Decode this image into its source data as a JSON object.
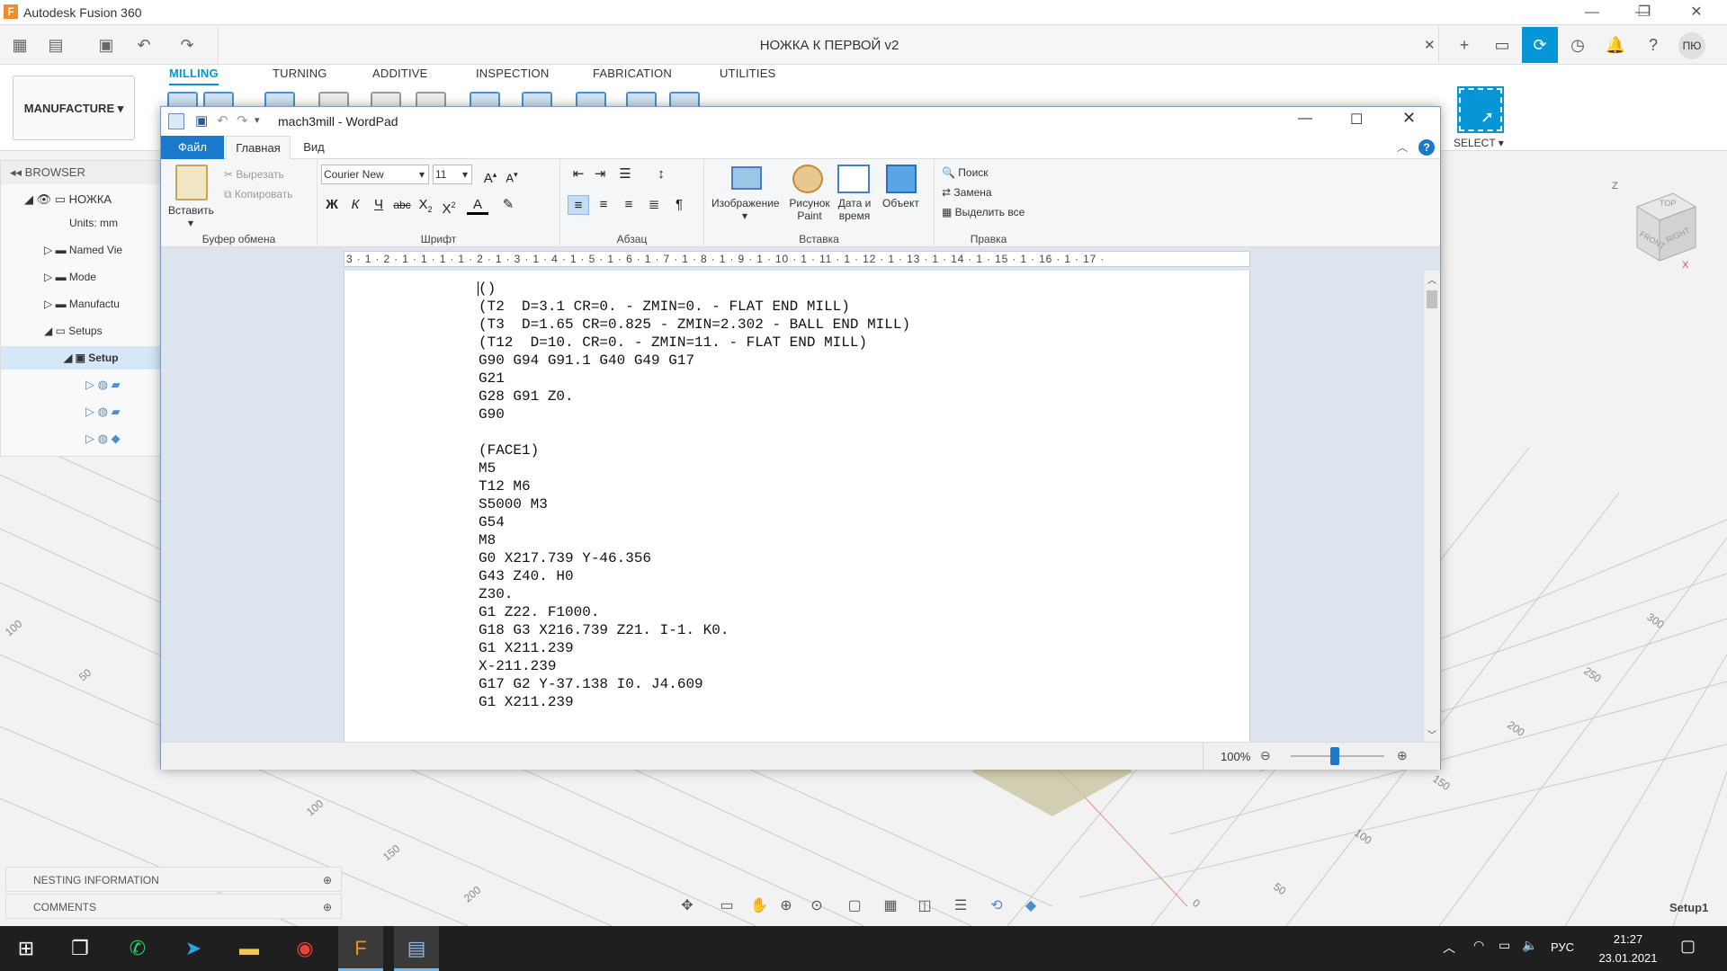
{
  "fusion": {
    "app_title": "Autodesk Fusion 360",
    "doc_name": "НОЖКА К ПЕРВОЙ v2",
    "user_initials": "ПЮ",
    "workspace": "MANUFACTURE",
    "tabs": [
      "MILLING",
      "TURNING",
      "ADDITIVE",
      "INSPECTION",
      "FABRICATION",
      "UTILITIES"
    ],
    "select_label": "SELECT ▾",
    "browser": {
      "header": "BROWSER",
      "root": "НОЖКА",
      "units": "Units: mm",
      "named_views": "Named Vie",
      "models": "Mode",
      "manufacture": "Manufactu",
      "setups": "Setups",
      "setup": "Setup"
    },
    "panels": {
      "nesting": "NESTING INFORMATION",
      "comments": "COMMENTS"
    },
    "status_right": "Setup1",
    "cube": {
      "top": "TOP",
      "front": "FRONT",
      "right": "RIGHT",
      "z": "Z",
      "x": "X"
    },
    "grid_labels": [
      "100",
      "50",
      "300",
      "250",
      "200",
      "150",
      "100",
      "50",
      "0",
      "200",
      "150",
      "100",
      "50",
      "0"
    ]
  },
  "wordpad": {
    "title": "mach3mill - WordPad",
    "tabs": {
      "file": "Файл",
      "home": "Главная",
      "view": "Вид"
    },
    "clipboard": {
      "paste": "Вставить",
      "cut": "Вырезать",
      "copy": "Копировать",
      "group": "Буфер обмена"
    },
    "font": {
      "name": "Courier New",
      "size": "11",
      "group": "Шрифт"
    },
    "paragraph_group": "Абзац",
    "insert": {
      "image": "Изображение",
      "paint_1": "Рисунок",
      "paint_2": "Paint",
      "datetime_1": "Дата и",
      "datetime_2": "время",
      "object": "Объект",
      "group": "Вставка"
    },
    "edit": {
      "find": "Поиск",
      "replace": "Замена",
      "select_all": "Выделить все",
      "group": "Правка"
    },
    "ruler_text": "3 · 1 · 2 · 1 · 1 · 1 · 1 · 2 · 1 · 3 · 1 · 4 · 1 · 5 · 1 · 6 · 1 · 7 · 1 · 8 · 1 · 9 · 1 · 10 · 1 · 11 · 1 · 12 · 1 · 13 · 1 · 14 · 1 · 15 · 1 · 16 · 1 · 17 ·",
    "lines": [
      "()",
      "(T2  D=3.1 CR=0. - ZMIN=0. - FLAT END MILL)",
      "(T3  D=1.65 CR=0.825 - ZMIN=2.302 - BALL END MILL)",
      "(T12  D=10. CR=0. - ZMIN=11. - FLAT END MILL)",
      "G90 G94 G91.1 G40 G49 G17",
      "G21",
      "G28 G91 Z0.",
      "G90",
      "",
      "(FACE1)",
      "M5",
      "T12 M6",
      "S5000 M3",
      "G54",
      "M8",
      "G0 X217.739 Y-46.356",
      "G43 Z40. H0",
      "Z30.",
      "G1 Z22. F1000.",
      "G18 G3 X216.739 Z21. I-1. K0.",
      "G1 X211.239",
      "X-211.239",
      "G17 G2 Y-37.138 I0. J4.609",
      "G1 X211.239"
    ],
    "zoom": "100%"
  },
  "taskbar": {
    "language": "РУС",
    "time": "21:27",
    "date": "23.01.2021"
  }
}
